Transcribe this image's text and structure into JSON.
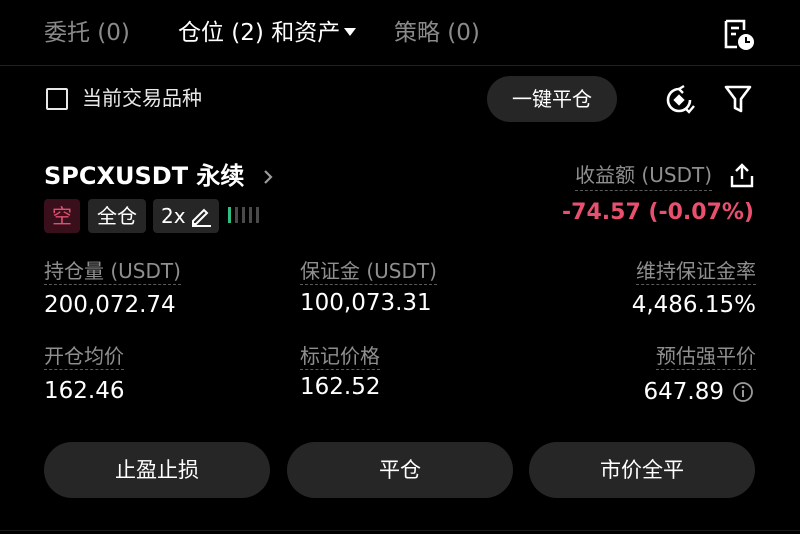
{
  "tabs": [
    {
      "label": "委托 (0)"
    },
    {
      "label": "仓位 (2) 和资产"
    },
    {
      "label": "策略 (0)"
    }
  ],
  "icons": {
    "history": "calendar-clock-icon",
    "account_mode": "coin-swap-icon",
    "filter": "funnel-icon",
    "share": "share-icon",
    "info": "info-icon",
    "edit": "pencil-icon",
    "chevron": "chevron-right-icon"
  },
  "filter_row": {
    "current_symbol_label": "当前交易品种",
    "close_all_label": "一键平仓"
  },
  "position": {
    "symbol": "SPCXUSDT 永续",
    "side": "空",
    "margin_mode": "全仓",
    "leverage": "2x",
    "risk_level_of_5": 1,
    "pnl_label": "收益额 (USDT)",
    "pnl_value": "-74.57 (-0.07%)",
    "stats": {
      "size_label": "持仓量 (USDT)",
      "size_value": "200,072.74",
      "margin_label": "保证金 (USDT)",
      "margin_value": "100,073.31",
      "mmr_label": "维持保证金率",
      "mmr_value": "4,486.15%",
      "entry_label": "开仓均价",
      "entry_value": "162.46",
      "mark_label": "标记价格",
      "mark_value": "162.52",
      "liq_label": "预估强平价",
      "liq_value": "647.89"
    }
  },
  "actions": {
    "tpsl": "止盈止损",
    "close": "平仓",
    "market_close": "市价全平"
  },
  "colors": {
    "background": "#000000",
    "negative": "#e8506e",
    "risk_green": "#2ebd85",
    "button_bg": "#262626"
  }
}
